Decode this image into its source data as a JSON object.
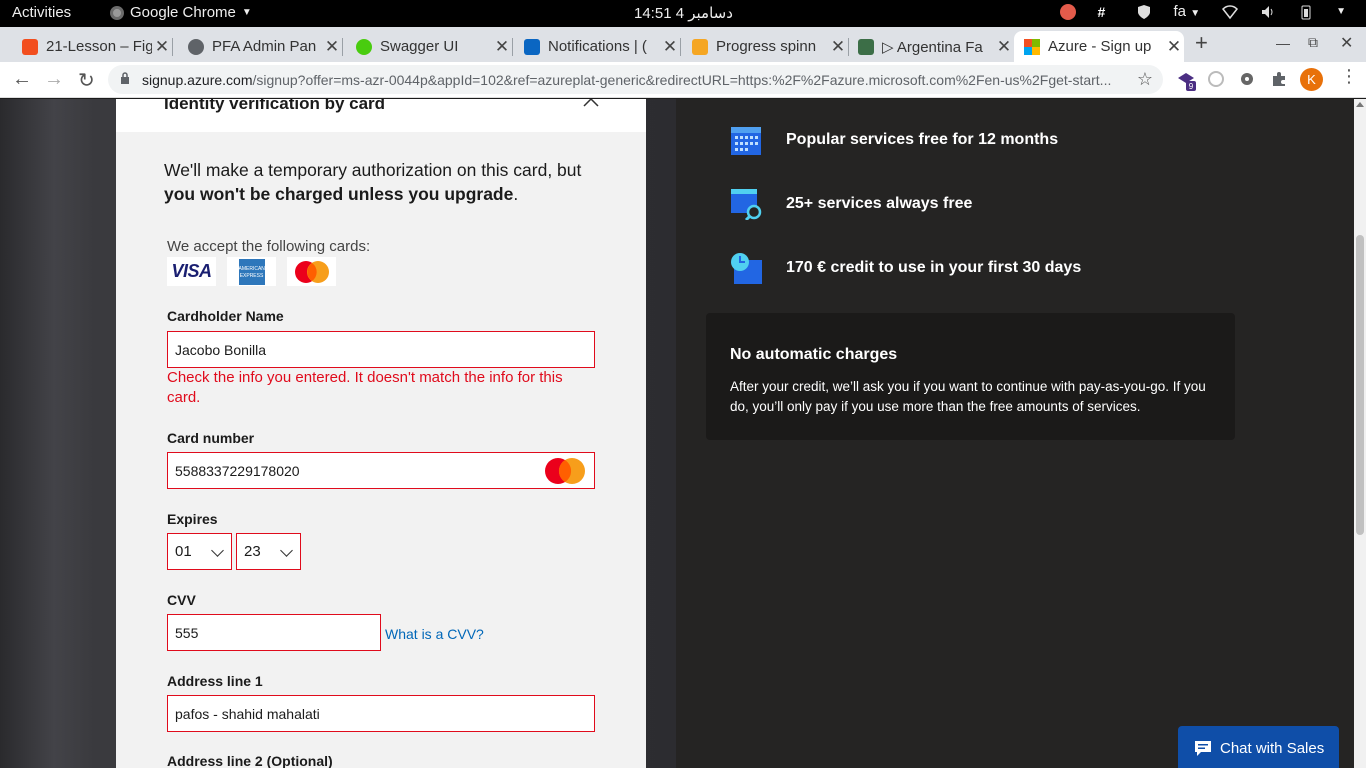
{
  "system": {
    "activities": "Activities",
    "app_name": "Google Chrome",
    "clock": "14:51  دسامبر 4",
    "language": "fa"
  },
  "tabs": [
    {
      "title": "21-Lesson – Fig",
      "color": "#f24e1e"
    },
    {
      "title": "PFA Admin Pan",
      "color": "#5f6368"
    },
    {
      "title": "Swagger UI",
      "color": "#49cc0f"
    },
    {
      "title": "Notifications | (",
      "color": "#0a66c2"
    },
    {
      "title": "Progress spinn",
      "color": "#f5a623"
    },
    {
      "title": "▷ Argentina Fa",
      "color": "#3c6e47"
    },
    {
      "title": "Azure - Sign up",
      "color": "#0078d4"
    }
  ],
  "address": {
    "domain": "signup.azure.com",
    "path": "/signup?offer=ms-azr-0044p&appId=102&ref=azureplat-generic&redirectURL=https:%2F%2Fazure.microsoft.com%2Fen-us%2Fget-start..."
  },
  "extensions": {
    "badge": "9",
    "profile_initial": "K"
  },
  "form": {
    "section_title": "Identity verification by card",
    "intro_plain": "We'll make a temporary authorization on this card, but ",
    "intro_bold": "you won't be charged unless you upgrade",
    "intro_end": ".",
    "accept_label": "We accept the following cards:",
    "card_logos": [
      "visa",
      "american-express",
      "mastercard"
    ],
    "visa_text": "VISA",
    "amex_text": "AMERICAN EXPRESS",
    "cardholder_label": "Cardholder Name",
    "cardholder_value": "Jacobo Bonilla",
    "cardholder_error": "Check the info you entered. It doesn't match the info for this card.",
    "card_number_label": "Card number",
    "card_number_value": "5588337229178020",
    "expires_label": "Expires",
    "expires_month": "01",
    "expires_year": "23",
    "cvv_label": "CVV",
    "cvv_value": "555",
    "cvv_help": "What is a CVV?",
    "address1_label": "Address line 1",
    "address1_value": "pafos - shahid mahalati",
    "address2_label": "Address line 2 (Optional)"
  },
  "benefits": {
    "items": [
      {
        "text": "Popular services free for 12 months",
        "icon": "calendar-icon"
      },
      {
        "text": "25+ services always free",
        "icon": "search-services-icon"
      },
      {
        "text": "170 € credit to use in your first 30 days",
        "icon": "clock-credit-icon"
      }
    ],
    "no_charges_title": "No automatic charges",
    "no_charges_body": "After your credit, we’ll ask you if you want to continue with pay-as-you-go. If you do, you’ll only pay if you use more than the free amounts of services."
  },
  "chat": {
    "label": "Chat with Sales"
  },
  "colors": {
    "error": "#e00b1c",
    "link": "#0067b8",
    "azure_blue": "#0f4ea8"
  }
}
